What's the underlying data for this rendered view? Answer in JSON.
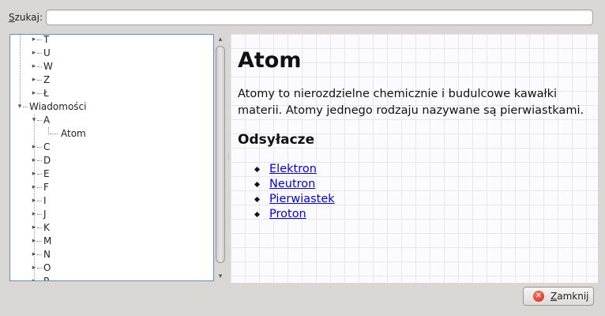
{
  "search": {
    "label_mnemonic": "S",
    "label_rest": "zukaj:",
    "value": ""
  },
  "tree": {
    "items": [
      {
        "label": "T"
      },
      {
        "label": "U"
      },
      {
        "label": "W"
      },
      {
        "label": "Z"
      },
      {
        "label": "Ł"
      },
      {
        "label": "Wiadomości"
      },
      {
        "label": "A"
      },
      {
        "label": "Atom"
      },
      {
        "label": "C"
      },
      {
        "label": "D"
      },
      {
        "label": "E"
      },
      {
        "label": "F"
      },
      {
        "label": "I"
      },
      {
        "label": "J"
      },
      {
        "label": "K"
      },
      {
        "label": "M"
      },
      {
        "label": "N"
      },
      {
        "label": "O"
      },
      {
        "label": "P"
      }
    ]
  },
  "article": {
    "title": "Atom",
    "body": "Atomy to nierozdzielne chemicznie i budulcowe kawałki materii. Atomy jednego rodzaju nazywane są pierwiastkami.",
    "links_heading": "Odsyłacze",
    "links": [
      "Elektron",
      "Neutron",
      "Pierwiastek",
      "Proton"
    ]
  },
  "footer": {
    "close_mnemonic": "Z",
    "close_rest": "amknij",
    "close_icon": "close-icon"
  },
  "colors": {
    "selection": "#3b78c4",
    "link": "#0000ee",
    "tree_border": "#5f8fcc"
  }
}
